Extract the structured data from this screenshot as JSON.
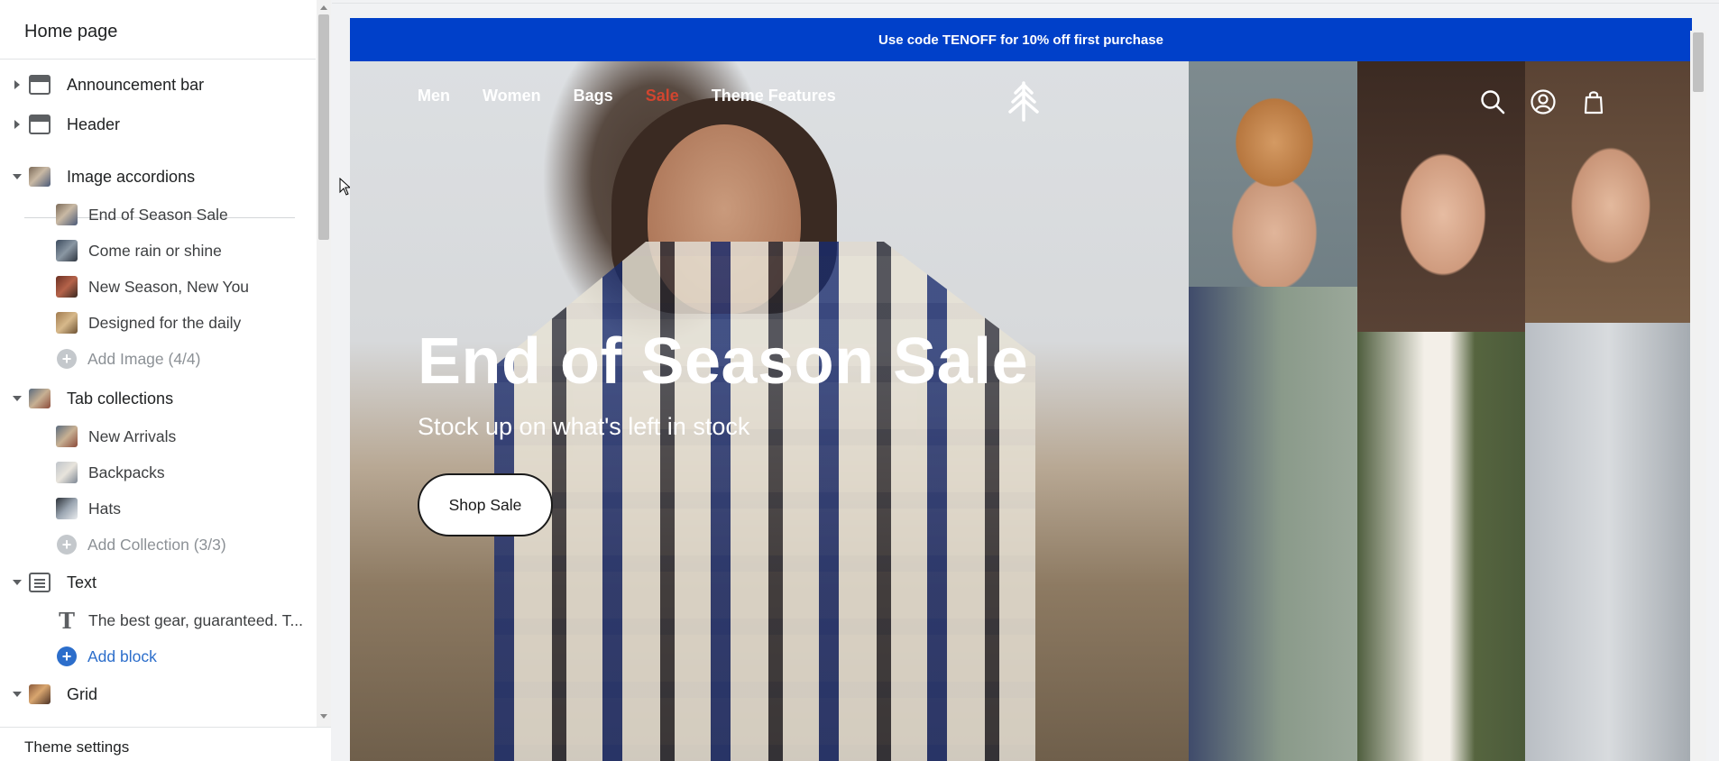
{
  "sidebar": {
    "title": "Home page",
    "footer_label": "Theme settings",
    "sections": {
      "announcement_bar": "Announcement bar",
      "header": "Header",
      "image_accordions": {
        "label": "Image accordions",
        "items": [
          "End of Season Sale",
          "Come rain or shine",
          "New Season, New You",
          "Designed for the daily"
        ],
        "add_label": "Add Image (4/4)"
      },
      "tab_collections": {
        "label": "Tab collections",
        "items": [
          "New Arrivals",
          "Backpacks",
          "Hats"
        ],
        "add_label": "Add Collection (3/3)"
      },
      "text": {
        "label": "Text",
        "items": [
          "The best gear, guaranteed. T..."
        ],
        "add_label": "Add block"
      },
      "grid": "Grid"
    }
  },
  "preview": {
    "announcement": {
      "prefix": "Use code ",
      "code": "TENOFF",
      "suffix": " for 10% off first purchase"
    },
    "nav": [
      "Men",
      "Women",
      "Bags",
      "Sale",
      "Theme Features"
    ],
    "hero": {
      "title": "End of Season Sale",
      "subtitle": "Stock up on what's left in stock",
      "button": "Shop Sale"
    }
  },
  "colors": {
    "announcement_bg": "#0040c9",
    "sale_nav": "#d2452f",
    "add_block_link": "#2c6ecb"
  },
  "icons": [
    "search-icon",
    "account-icon",
    "cart-icon",
    "logo-tree-icon"
  ]
}
